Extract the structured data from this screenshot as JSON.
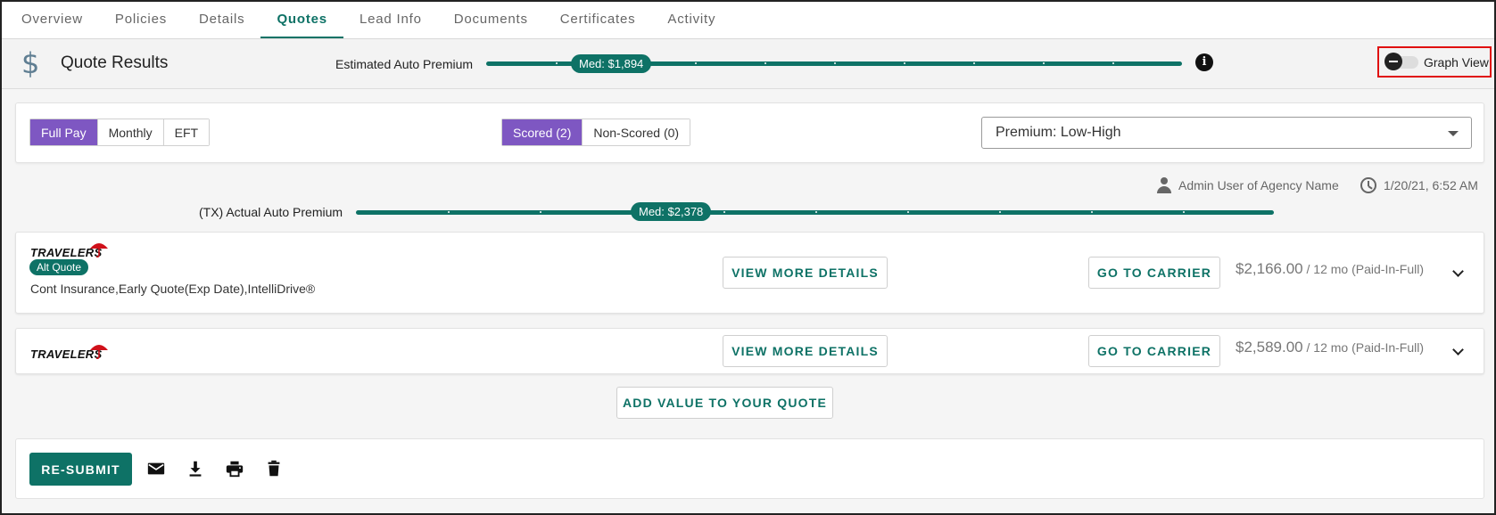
{
  "tabs": [
    {
      "label": "Overview"
    },
    {
      "label": "Policies"
    },
    {
      "label": "Details"
    },
    {
      "label": "Quotes",
      "active": true
    },
    {
      "label": "Lead Info"
    },
    {
      "label": "Documents"
    },
    {
      "label": "Certificates"
    },
    {
      "label": "Activity"
    }
  ],
  "header": {
    "icon": "dollar-icon",
    "title": "Quote Results",
    "estimate_label": "Estimated Auto Premium",
    "estimate_median": "Med: $1,894",
    "graph_view_label": "Graph View",
    "graph_view_on": false
  },
  "filters": {
    "pay_options": [
      "Full Pay",
      "Monthly",
      "EFT"
    ],
    "pay_selected": "Full Pay",
    "score_options": [
      "Scored (2)",
      "Non-Scored (0)"
    ],
    "score_selected": "Scored (2)",
    "sort_value": "Premium: Low-High"
  },
  "meta": {
    "user": "Admin User of Agency Name",
    "timestamp": "1/20/21, 6:52 AM"
  },
  "actual": {
    "label": "(TX) Actual Auto Premium",
    "median": "Med: $2,378"
  },
  "quotes": [
    {
      "carrier": "TRAVELERS",
      "badge": "Alt Quote",
      "description": "Cont Insurance,Early Quote(Exp Date),IntelliDrive®",
      "details_label": "VIEW MORE DETAILS",
      "carrier_label": "GO TO CARRIER",
      "price": "$2,166.00",
      "term": "/ 12 mo (Paid-In-Full)"
    },
    {
      "carrier": "TRAVELERS",
      "details_label": "VIEW MORE DETAILS",
      "carrier_label": "GO TO CARRIER",
      "price": "$2,589.00",
      "term": "/ 12 mo (Paid-In-Full)"
    }
  ],
  "add_value_label": "ADD VALUE TO YOUR QUOTE",
  "actions": {
    "resubmit_label": "RE-SUBMIT",
    "icons": [
      "email-icon",
      "download-icon",
      "print-icon",
      "delete-icon"
    ]
  },
  "colors": {
    "primary": "#0e7266",
    "selected_segment": "#7e57c2",
    "highlight_border": "#e01010",
    "carrier_red": "#d0101a"
  }
}
